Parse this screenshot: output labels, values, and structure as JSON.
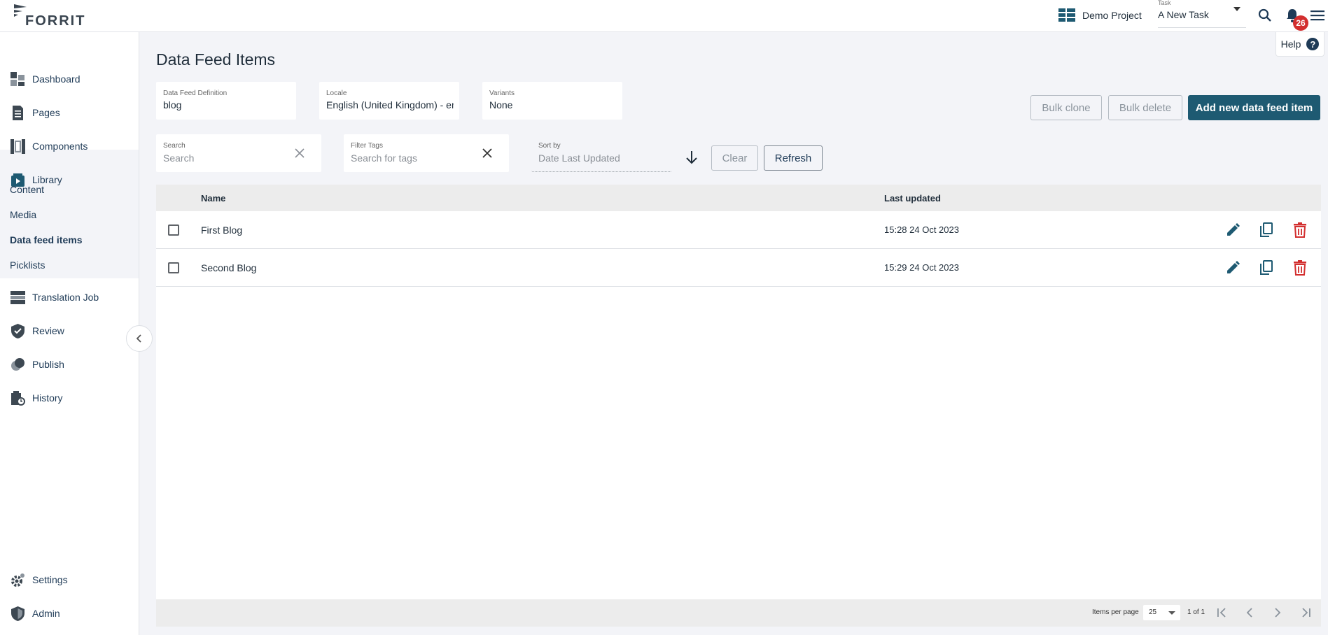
{
  "brand": {
    "logo_text": "FORRIT"
  },
  "header": {
    "project": "Demo Project",
    "task_label": "Task",
    "task_value": "A New Task",
    "notification_count": "26",
    "help_label": "Help",
    "help_glyph": "?"
  },
  "sidebar": {
    "items": [
      {
        "label": "Dashboard",
        "icon": "dashboard-icon"
      },
      {
        "label": "Pages",
        "icon": "pages-icon"
      },
      {
        "label": "Components",
        "icon": "components-icon"
      },
      {
        "label": "Library",
        "icon": "library-icon"
      },
      {
        "label": "Translation Job",
        "icon": "translation-job-icon"
      },
      {
        "label": "Review",
        "icon": "review-shield-icon"
      },
      {
        "label": "Publish",
        "icon": "publish-icon"
      },
      {
        "label": "History",
        "icon": "history-icon"
      },
      {
        "label": "Settings",
        "icon": "settings-gear-icon"
      },
      {
        "label": "Admin",
        "icon": "admin-shield-icon"
      }
    ],
    "library_sub": [
      "Content",
      "Media",
      "Data feed items",
      "Picklists"
    ],
    "active_sub": "Data feed items"
  },
  "page": {
    "title": "Data Feed Items"
  },
  "filters": {
    "definition": {
      "label": "Data Feed Definition",
      "value": "blog"
    },
    "locale": {
      "label": "Locale",
      "value": "English (United Kingdom) - en-GB"
    },
    "variants": {
      "label": "Variants",
      "value": "None"
    },
    "search": {
      "label": "Search",
      "placeholder": "Search"
    },
    "tags": {
      "label": "Filter Tags",
      "placeholder": "Search for tags"
    },
    "sort": {
      "label": "Sort by",
      "placeholder": "Date Last Updated"
    }
  },
  "actions": {
    "bulk_clone": "Bulk clone",
    "bulk_delete": "Bulk delete",
    "add_new": "Add new data feed item",
    "clear": "Clear",
    "refresh": "Refresh"
  },
  "table": {
    "columns": [
      "Name",
      "Last updated"
    ],
    "rows": [
      {
        "name": "First Blog",
        "updated": "15:28 24 Oct 2023"
      },
      {
        "name": "Second Blog",
        "updated": "15:29 24 Oct 2023"
      }
    ]
  },
  "pagination": {
    "items_per_page_label": "Items per page",
    "items_per_page": "25",
    "range": "1 of 1"
  },
  "colors": {
    "primary": "#1e5a72",
    "danger": "#d32f2f",
    "nav_text": "#1f3b57"
  }
}
